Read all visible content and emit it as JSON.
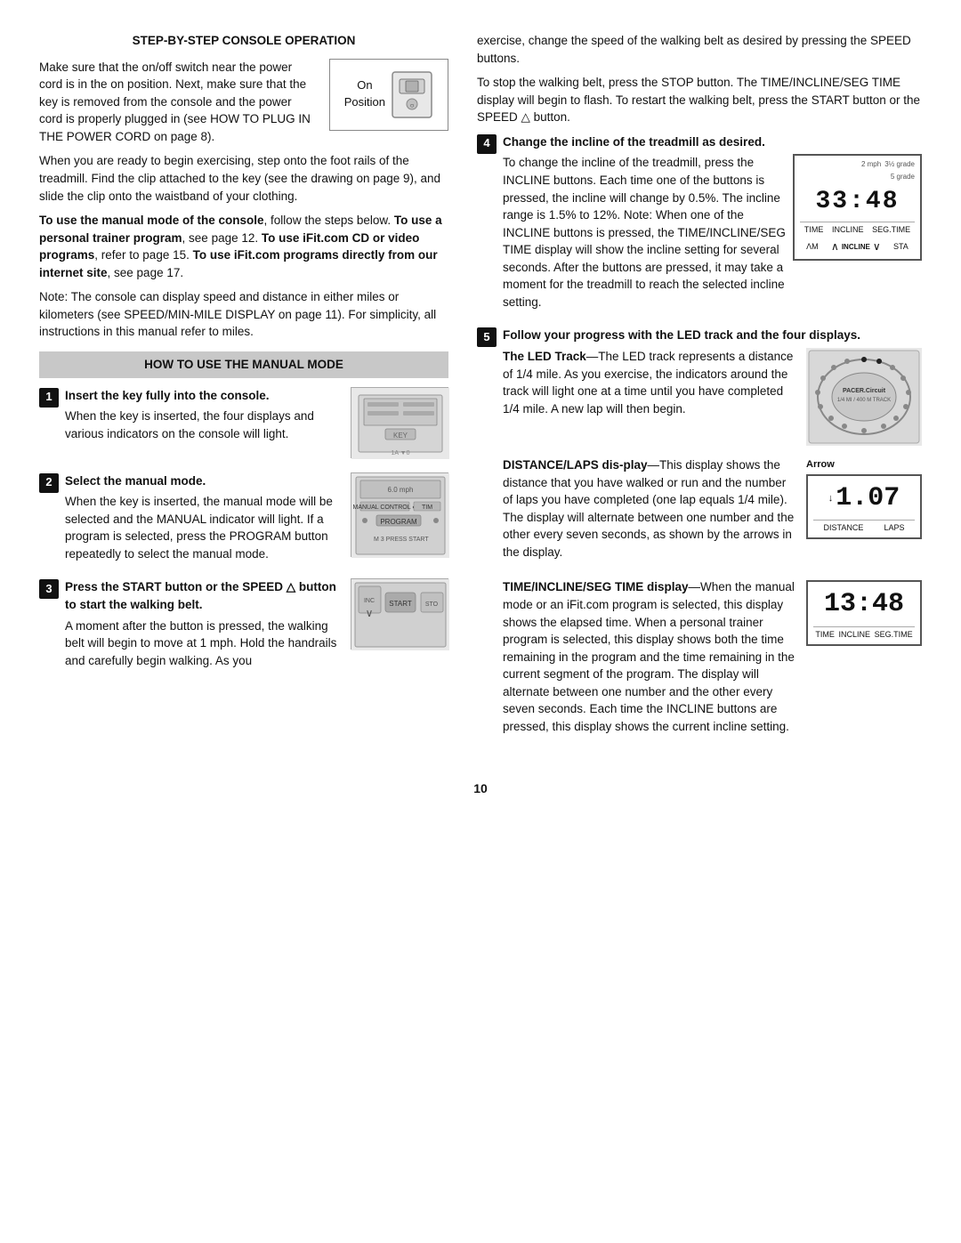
{
  "header": {
    "step_by_step": "STEP-BY-STEP CONSOLE OPERATION"
  },
  "left": {
    "intro_paras": [
      "Make sure that the on/off switch near the power cord is in the on position. Next, make sure that the key is removed from the console and the power cord is properly plugged in (see HOW TO PLUG IN THE POWER CORD on page 8).",
      "When you are ready to begin exercising, step onto the foot rails of the treadmill. Find the clip attached to the key (see the drawing on page 9), and slide the clip onto the waistband of your clothing."
    ],
    "bold_para": "To use the manual mode of the console, follow the steps below. To use a personal trainer program, see page 12. To use iFit.com CD or video programs, refer to page 15. To use iFit.com programs directly from our internet site, see page 17.",
    "note_para": "Note: The console can display speed and distance in either miles or kilometers (see SPEED/MIN-MILE DISPLAY on page 11). For simplicity, all instructions in this manual refer to miles.",
    "on_position_label1": "On",
    "on_position_label2": "Position",
    "manual_mode_heading": "HOW TO USE THE MANUAL MODE",
    "steps": [
      {
        "num": "1",
        "title": "Insert the key fully into the console.",
        "body": "When the key is inserted, the four displays and various indicators on the console will light."
      },
      {
        "num": "2",
        "title": "Select the manual mode.",
        "body": "When the key is inserted, the manual mode will be selected and the MANUAL indicator will light. If a program is selected, press the PROGRAM button repeatedly to select the manual mode."
      },
      {
        "num": "3",
        "title": "Press the START button or the SPEED △ button to start the walking belt.",
        "body": "A moment after the button is pressed, the walking belt will begin to move at 1 mph. Hold the handrails and carefully begin walking. As you"
      }
    ]
  },
  "right": {
    "intro_paras": [
      "exercise, change the speed of the walking belt as desired by pressing the SPEED buttons.",
      "To stop the walking belt, press the STOP button. The TIME/INCLINE/SEG TIME display will begin to flash. To restart the walking belt, press the START button or the SPEED △ button."
    ],
    "step4": {
      "num": "4",
      "title": "Change the incline of the treadmill as desired.",
      "body": "To change the incline of the treadmill, press the INCLINE buttons. Each time one of the buttons is pressed, the incline will change by 0.5%. The incline range is 1.5% to 12%. Note: When one of the INCLINE buttons is pressed, the TIME/INCLINE/SEG TIME display will show the incline setting for several seconds. After the buttons are pressed, it may take a moment for the treadmill to reach the selected incline setting.",
      "display_num": "33:48",
      "display_labels": [
        "TIME",
        "INCLINE",
        "SEG.TIME"
      ]
    },
    "step5": {
      "num": "5",
      "title": "Follow your progress with the LED track and the four displays.",
      "subsections": [
        {
          "id": "led",
          "heading": "The LED Track",
          "body": "—The LED track represents a distance of 1/4 mile. As you exercise, the indicators around the track will light one at a time until you have completed 1/4 mile. A new lap will then begin."
        },
        {
          "id": "distance",
          "heading": "DISTANCE/LAPS display",
          "body_bold": "DISTANCE/LAPS dis-play",
          "body": "—This display shows the distance that you have walked or run and the number of laps you have completed (one lap equals 1/4 mile). The display will alternate between one number and the other every seven seconds, as shown by the arrows in the display.",
          "display_num": "1.07",
          "display_labels": [
            "DISTANCE",
            "LAPS"
          ],
          "arrow_label": "Arrow"
        },
        {
          "id": "time",
          "heading": "TIME/INCLINE/SEG TIME display",
          "body_bold": "TIME/INCLINE/SEG TIME display",
          "body": "—When the manual mode or an iFit.com program is selected, this display shows the elapsed time. When a personal trainer program is selected, this display shows both the time remaining in the program and the time remaining in the current segment of the program. The display will alternate between one number and the other every seven seconds. Each time the INCLINE buttons are pressed, this display shows the current incline setting.",
          "display_num": "13:48",
          "display_labels": [
            "TIME",
            "INCLINE",
            "SEG.TIME"
          ]
        }
      ]
    }
  },
  "footer": {
    "page_num": "10"
  }
}
